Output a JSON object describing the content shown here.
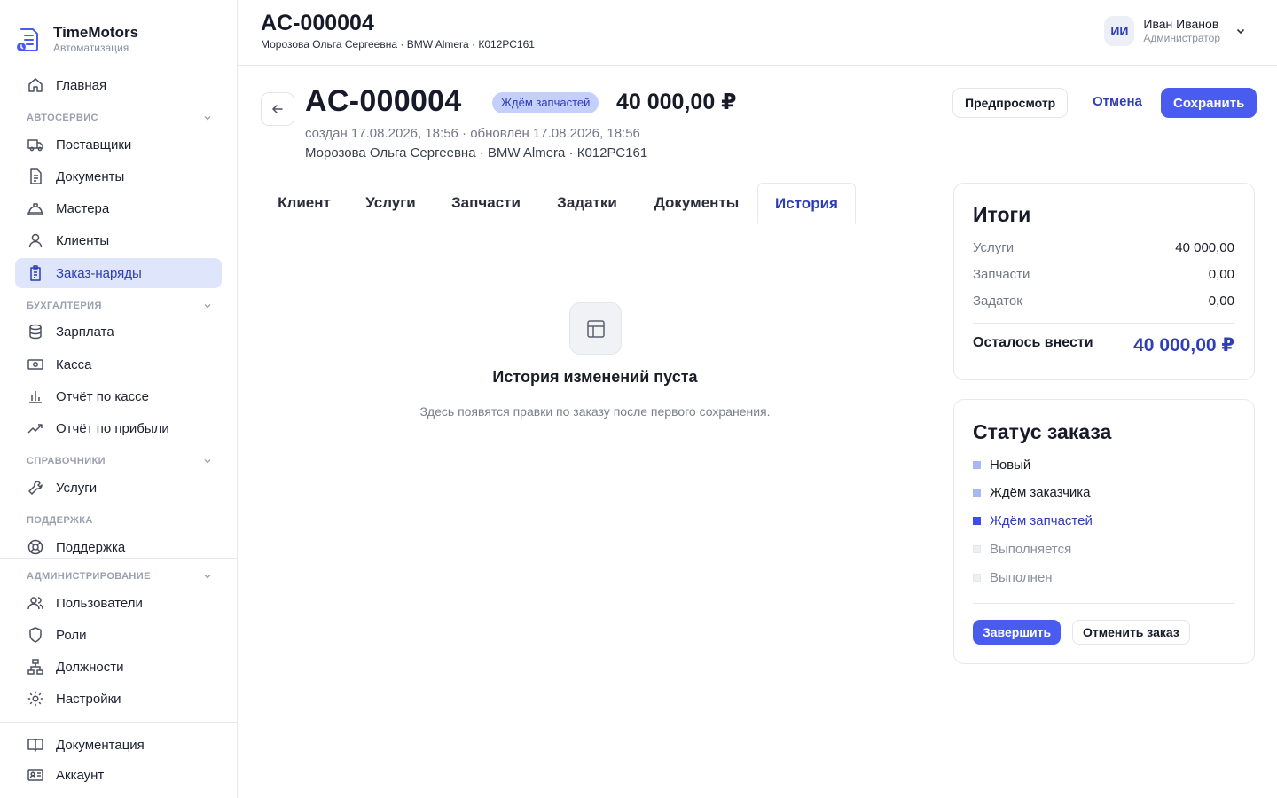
{
  "brand": {
    "name": "TimeMotors",
    "subtitle": "Автоматизация"
  },
  "sidebar": {
    "home": "Главная",
    "sections": {
      "autoservice": "АВТОСЕРВИС",
      "accounting": "БУХГАЛТЕРИЯ",
      "references": "СПРАВОЧНИКИ",
      "support": "ПОДДЕРЖКА",
      "admin": "АДМИНИСТРИРОВАНИЕ"
    },
    "items": {
      "suppliers": "Поставщики",
      "documents": "Документы",
      "masters": "Мастера",
      "clients": "Клиенты",
      "work_orders": "Заказ-наряды",
      "salary": "Зарплата",
      "cashbox": "Касса",
      "cash_report": "Отчёт по кассе",
      "profit_report": "Отчёт по прибыли",
      "services": "Услуги",
      "support": "Поддержка",
      "users": "Пользователи",
      "roles": "Роли",
      "positions": "Должности",
      "settings": "Настройки",
      "documentation": "Документация",
      "account": "Аккаунт"
    },
    "active_item": "work_orders"
  },
  "header": {
    "title": "AC-000004",
    "subtitle": "Морозова Ольга Сергеевна · BMW Almera · К012РС161"
  },
  "user": {
    "initials": "ИИ",
    "name": "Иван Иванов",
    "role": "Администратор"
  },
  "order": {
    "number": "AC-000004",
    "status": "Ждём запчастей",
    "total": "40 000,00 ₽",
    "meta": "создан 17.08.2026, 18:56 · обновлён 17.08.2026, 18:56",
    "client_line": "Морозова Ольга Сергеевна · BMW Almera · К012РС161"
  },
  "actions": {
    "preview": "Предпросмотр",
    "cancel": "Отмена",
    "save": "Сохранить"
  },
  "tabs": [
    "Клиент",
    "Услуги",
    "Запчасти",
    "Задатки",
    "Документы",
    "История"
  ],
  "active_tab": "История",
  "empty_state": {
    "title": "История изменений пуста",
    "text": "Здесь появятся правки по заказу после первого сохранения."
  },
  "totals": {
    "title": "Итоги",
    "rows": [
      {
        "label": "Услуги",
        "value": "40 000,00"
      },
      {
        "label": "Запчасти",
        "value": "0,00"
      },
      {
        "label": "Задаток",
        "value": "0,00"
      }
    ],
    "due_label": "Осталось внести",
    "due_value": "40 000,00 ₽"
  },
  "order_status": {
    "title": "Статус заказа",
    "items": [
      {
        "label": "Новый",
        "state": "done"
      },
      {
        "label": "Ждём заказчика",
        "state": "done"
      },
      {
        "label": "Ждём запчастей",
        "state": "current"
      },
      {
        "label": "Выполняется",
        "state": "pending"
      },
      {
        "label": "Выполнен",
        "state": "pending"
      }
    ],
    "complete_label": "Завершить",
    "cancel_order_label": "Отменить заказ"
  },
  "colors": {
    "accent": "#4a5cf0",
    "accent_text": "#2f3db6",
    "active_nav_bg": "#dfe5fb",
    "status_done": "#aab6f5",
    "status_current": "#3d4ee6",
    "status_pending": "#eef0f5"
  }
}
